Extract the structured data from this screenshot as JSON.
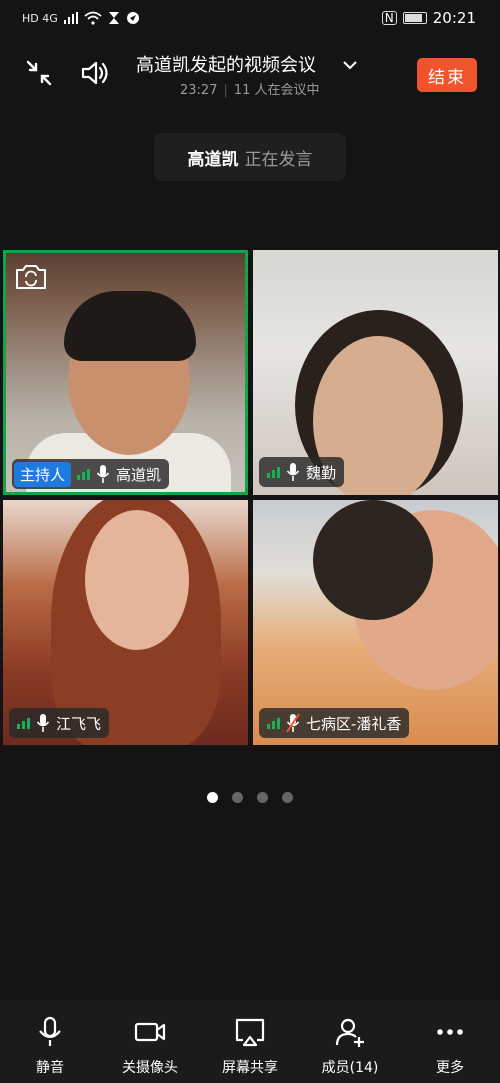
{
  "status_bar": {
    "time": "20:21",
    "network": "HD 4G"
  },
  "meeting": {
    "title": "高道凯发起的视频会议",
    "duration": "23:27",
    "participants_text": "11 人在会议中",
    "end_label": "结束"
  },
  "speaking": {
    "name": "高道凯",
    "state": "正在发言"
  },
  "tiles": [
    {
      "name": "高道凯",
      "host_label": "主持人",
      "muted": false
    },
    {
      "name": "魏勤",
      "muted": false
    },
    {
      "name": "江飞飞",
      "muted": false
    },
    {
      "name": "七病区-潘礼香",
      "muted": true
    }
  ],
  "pager": {
    "pages": 4,
    "current": 1
  },
  "toolbar": {
    "mute": "静音",
    "camera_off": "关摄像头",
    "share_screen": "屏幕共享",
    "members": "成员(14)",
    "more": "更多"
  },
  "colors": {
    "accent_end": "#f1542c",
    "active_speaker_border": "#13a34b",
    "host_badge": "#1f7ae0",
    "signal": "#19b157"
  }
}
